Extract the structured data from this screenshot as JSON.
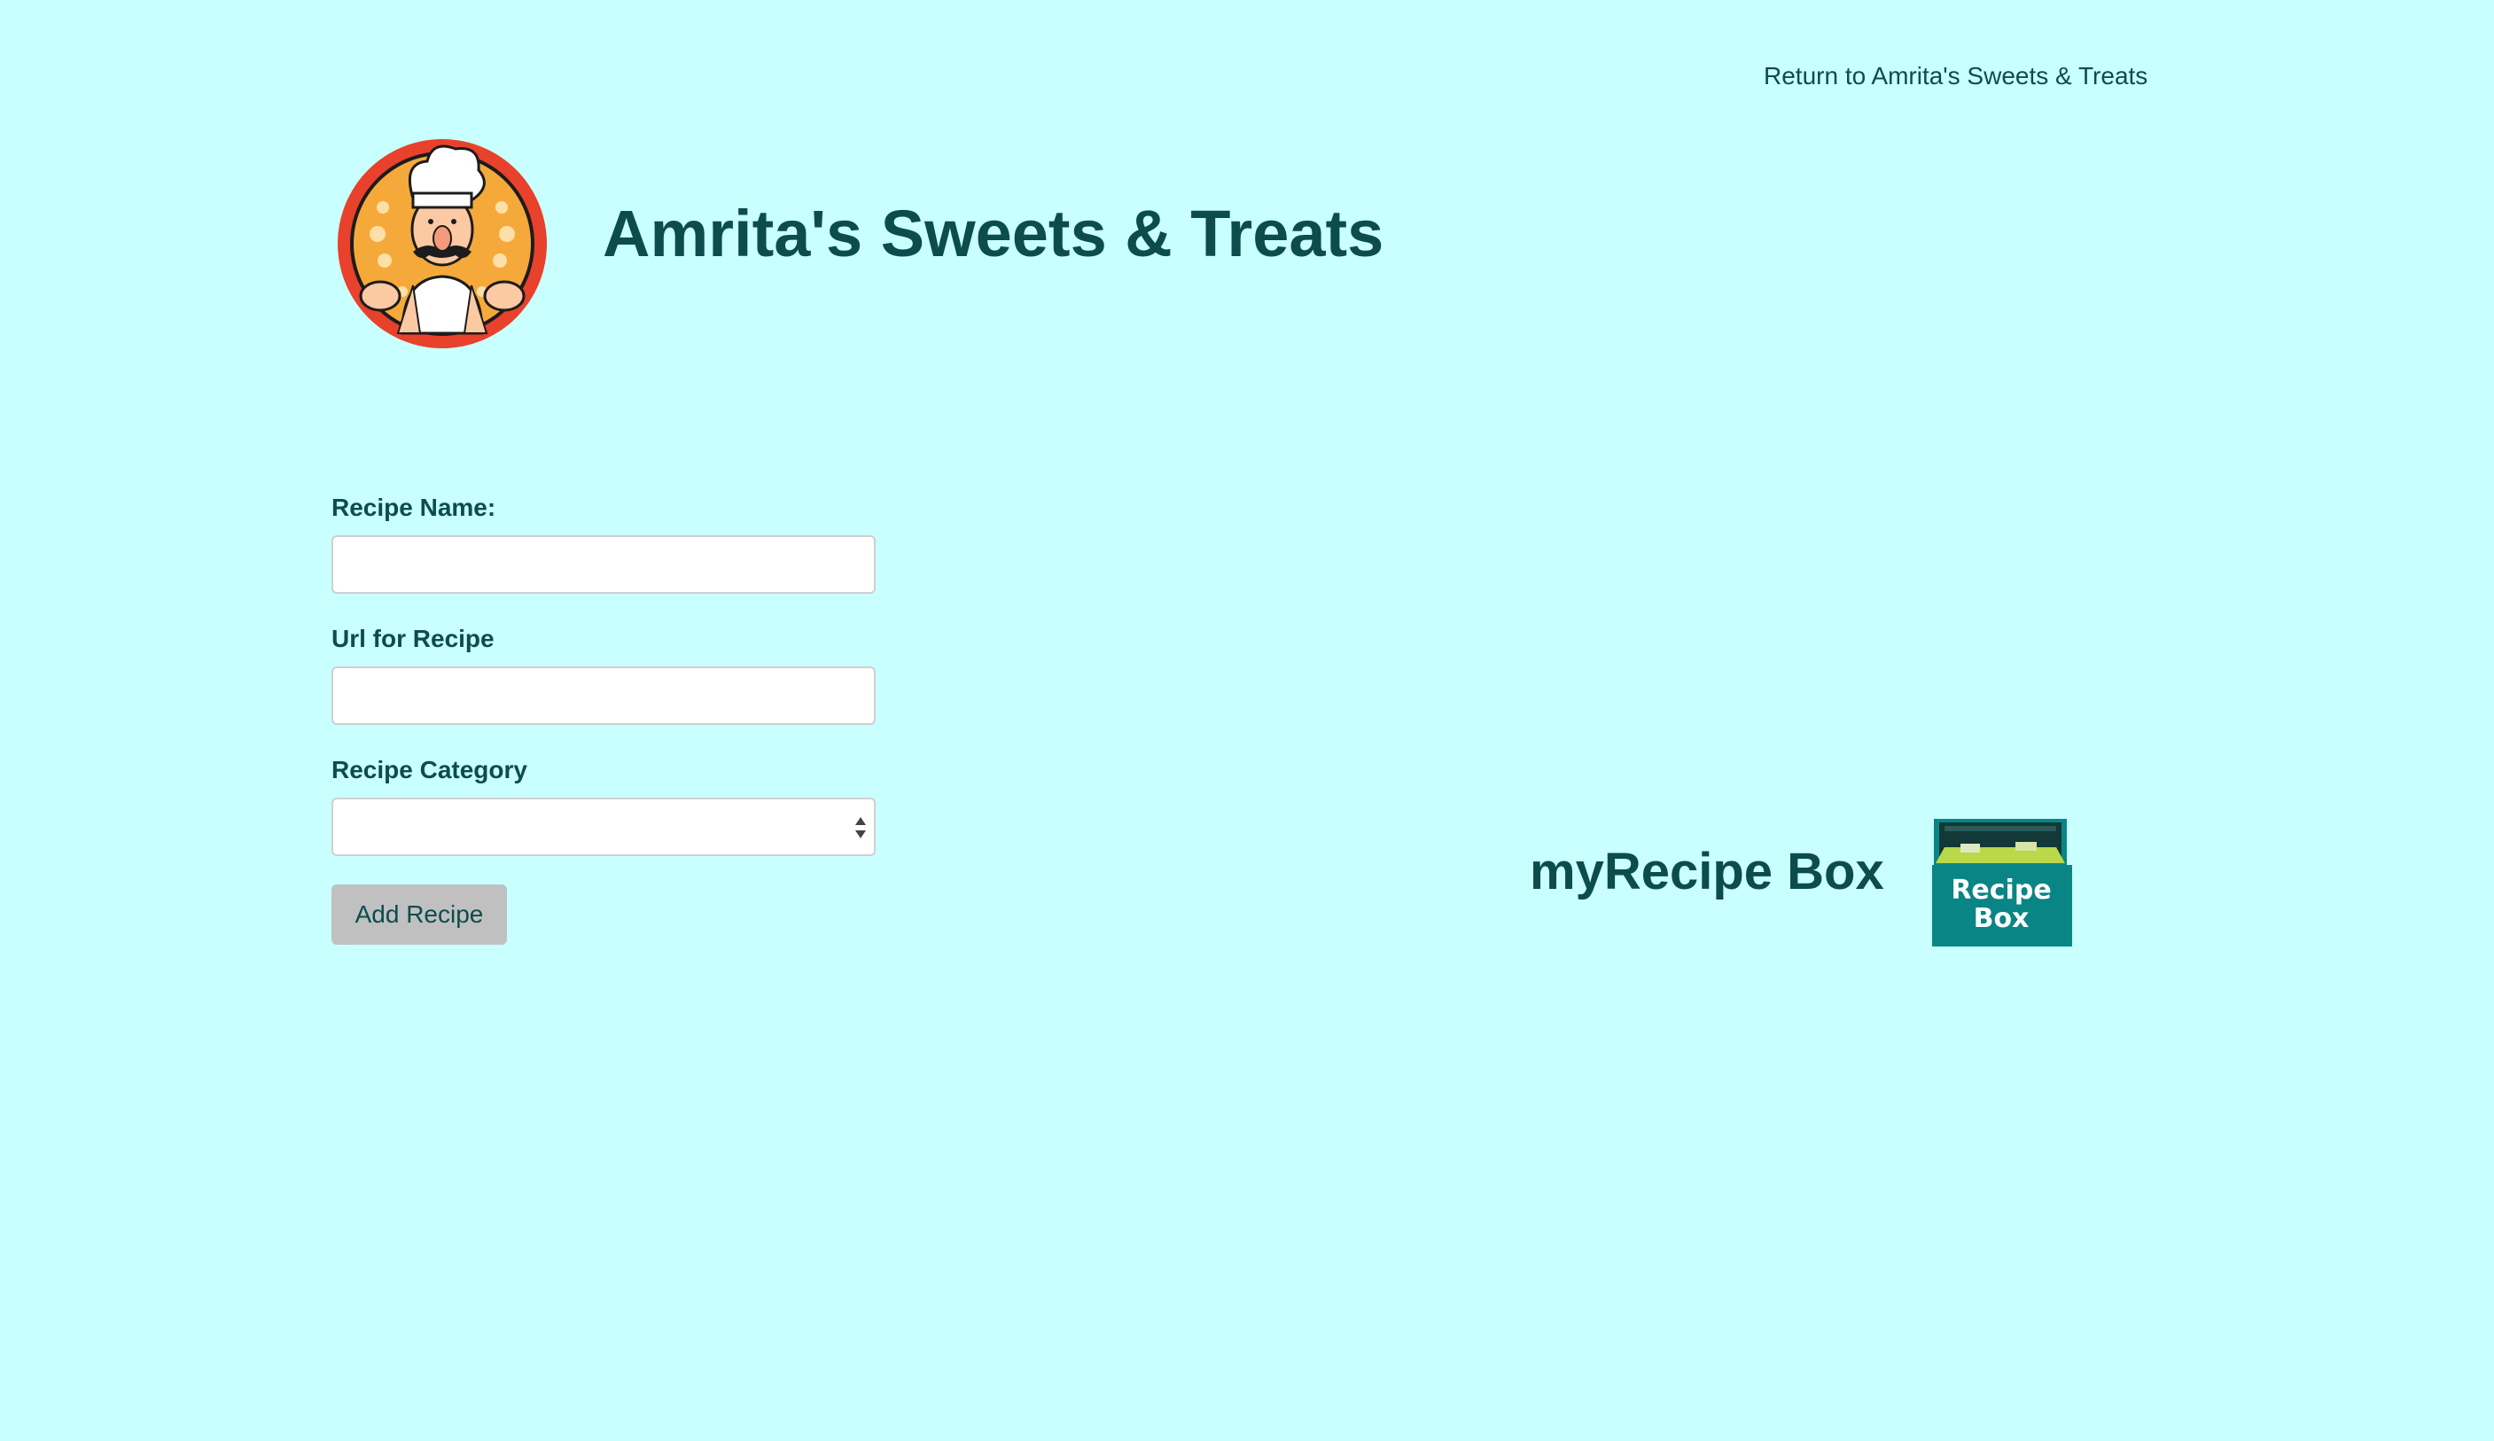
{
  "header": {
    "return_link": "Return to Amrita's Sweets & Treats",
    "site_title": "Amrita's Sweets & Treats",
    "logo_icon": "chef-logo-icon"
  },
  "form": {
    "recipe_name_label": "Recipe Name:",
    "recipe_name_value": "",
    "url_label": "Url for Recipe",
    "url_value": "",
    "category_label": "Recipe Category",
    "category_selected": "",
    "add_button_label": "Add Recipe"
  },
  "recipe_box": {
    "title": "myRecipe Box",
    "icon_text_line1": "Recipe",
    "icon_text_line2": "Box",
    "icon": "recipe-box-icon"
  },
  "colors": {
    "background": "#c9ffff",
    "text": "#0c4c4c",
    "button": "#c0c0c0",
    "logo_ring": "#e8412c",
    "box_teal": "#0a8585"
  }
}
